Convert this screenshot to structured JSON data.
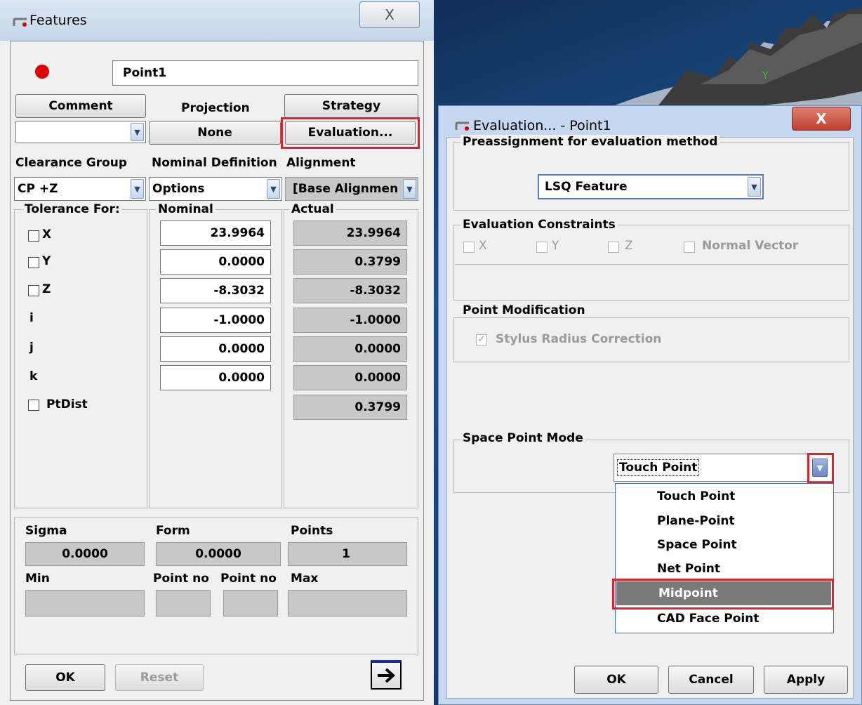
{
  "features_window": {
    "title": "Features",
    "close_label": "X",
    "feature_name": "Point1",
    "comment_label": "Comment",
    "projection_label": "Projection",
    "strategy_label": "Strategy",
    "comment_value": "",
    "projection_value": "None",
    "evaluation_label": "Evaluation...",
    "clearance_group_label": "Clearance Group",
    "nominal_definition_label": "Nominal Definition",
    "alignment_label": "Alignment",
    "clearance_group_value": "CP +Z",
    "nominal_definition_value": "Options",
    "alignment_value": "[Base Alignmen",
    "tolerance_for_label": "Tolerance For:",
    "nominal_header": "Nominal",
    "actual_header": "Actual",
    "rows": [
      {
        "label": "X",
        "checkbox": true,
        "nominal": "23.9964",
        "actual": "23.9964"
      },
      {
        "label": "Y",
        "checkbox": true,
        "nominal": "0.0000",
        "actual": "0.3799"
      },
      {
        "label": "Z",
        "checkbox": true,
        "nominal": "-8.3032",
        "actual": "-8.3032"
      },
      {
        "label": "i",
        "checkbox": false,
        "nominal": "-1.0000",
        "actual": "-1.0000"
      },
      {
        "label": "j",
        "checkbox": false,
        "nominal": "0.0000",
        "actual": "0.0000"
      },
      {
        "label": "k",
        "checkbox": false,
        "nominal": "0.0000",
        "actual": "0.0000"
      },
      {
        "label": "PtDist",
        "checkbox": true,
        "nominal": "",
        "actual": "0.3799"
      }
    ],
    "stats": {
      "sigma_label": "Sigma",
      "form_label": "Form",
      "points_label": "Points",
      "sigma_value": "0.0000",
      "form_value": "0.0000",
      "points_value": "1",
      "min_label": "Min",
      "point_no_label_1": "Point no",
      "point_no_label_2": "Point no",
      "max_label": "Max"
    },
    "ok_label": "OK",
    "reset_label": "Reset",
    "arrow_icon": "arrow-right"
  },
  "viewport": {
    "axis_label": "Y"
  },
  "evaluation_window": {
    "title": "Evaluation... - Point1",
    "close_label": "X",
    "preassignment_label": "Preassignment for evaluation method",
    "preassignment_value": "LSQ Feature",
    "constraints_label": "Evaluation Constraints",
    "constraint_x": "X",
    "constraint_y": "Y",
    "constraint_z": "Z",
    "constraint_normal": "Normal Vector",
    "point_modification_label": "Point Modification",
    "stylus_radius_label": "Stylus Radius Correction",
    "space_point_mode_label": "Space Point Mode",
    "space_point_mode_value": "Touch Point",
    "options": [
      "Touch Point",
      "Plane-Point",
      "Space Point",
      "Net Point",
      "Midpoint",
      "CAD Face Point"
    ],
    "selected_option": "Midpoint",
    "ok_label": "OK",
    "cancel_label": "Cancel",
    "apply_label": "Apply"
  },
  "colors": {
    "highlight_red": "#e0202a",
    "status_dot": "#e00000",
    "selected_item_bg": "#7a7a7a"
  }
}
